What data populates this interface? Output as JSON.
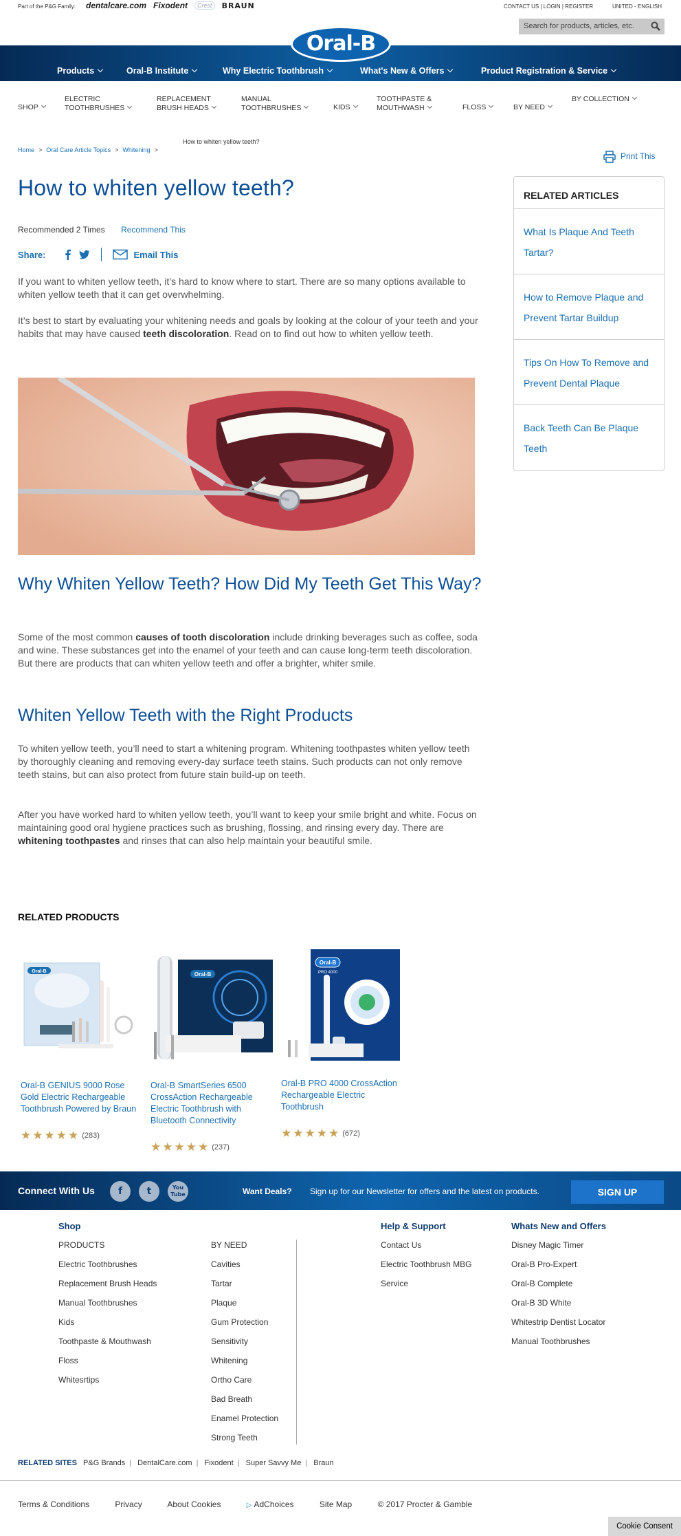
{
  "topbar": {
    "family": "Part of the P&G Family:",
    "brands": [
      "dentalcare.com",
      "Fixodent",
      "Crest",
      "BRAUN"
    ],
    "util": "CONTACT US | LOGIN | REGISTER",
    "region": "UNITED - ENGLISH"
  },
  "search": {
    "placeholder": "Search for products, articles, etc."
  },
  "logo": "Oral-B",
  "mainnav": [
    "Products",
    "Oral-B Institute",
    "Why Electric Toothbrush",
    "What's New & Offers",
    "Product Registration & Service"
  ],
  "subnav": [
    "SHOP",
    "ELECTRIC TOOTHBRUSHES",
    "REPLACEMENT BRUSH HEADS",
    "MANUAL TOOTHBRUSHES",
    "KIDS",
    "TOOTHPASTE & MOUTHWASH",
    "FLOSS",
    "BY NEED",
    "BY COLLECTION"
  ],
  "breadcrumb": {
    "items": [
      "Home",
      "Oral Care Article Topics",
      "Whitening"
    ],
    "sep": ">",
    "current": "How to whiten yellow teeth?"
  },
  "print": "Print This",
  "article": {
    "title": "How to whiten yellow teeth?",
    "recommended": "Recommended 2 Times",
    "recommend_link": "Recommend This",
    "share_label": "Share:",
    "email": "Email This",
    "p1": "If you want to whiten yellow teeth, it’s hard to know where to start. There are so many options available to whiten yellow teeth that it can get overwhelming.",
    "p2a": "It’s best to start by evaluating your whitening needs and goals by looking at the colour of your teeth and your habits that may have caused ",
    "p2b": "teeth discoloration",
    "p2c": ". Read on to find out how to whiten yellow teeth.",
    "h2a": "Why Whiten Yellow Teeth? How Did My Teeth Get This Way?",
    "p3a": "Some of the most common ",
    "p3b": "causes of tooth discoloration",
    "p3c": " include drinking beverages such as coffee, soda and wine. These substances get into the enamel of your teeth and can cause long-term teeth discoloration. But there are products that can whiten yellow teeth and offer a brighter, whiter smile.",
    "h2b": "Whiten Yellow Teeth with the Right Products",
    "p4": "To whiten yellow teeth, you’ll need to start a whitening program. Whitening toothpastes whiten yellow teeth by thoroughly cleaning and removing every-day surface teeth stains. Such products can not only remove teeth stains, but can also protect from future stain build-up on teeth.",
    "p5a": "After you have worked hard to whiten yellow teeth, you’ll want to keep your smile bright and white. Focus on maintaining good oral hygiene practices such as brushing, flossing, and rinsing every day. There are ",
    "p5b": "whitening toothpastes",
    "p5c": " and rinses that can also help maintain your beautiful smile."
  },
  "related_articles": {
    "title": "RELATED ARTICLES",
    "items": [
      "What Is Plaque And Teeth Tartar?",
      "How to Remove Plaque and Prevent Tartar Buildup",
      "Tips On How To Remove and Prevent Dental Plaque",
      "Back Teeth Can Be Plaque Teeth"
    ]
  },
  "related_products": {
    "title": "RELATED PRODUCTS",
    "items": [
      {
        "name": "Oral-B GENIUS 9000 Rose Gold Electric Rechargeable Toothbrush Powered by Braun",
        "stars": "★★★★★",
        "count": "(283)",
        "rating": 5
      },
      {
        "name": "Oral-B SmartSeries 6500 CrossAction Rechargeable Electric Toothbrush with Bluetooth Connectivity",
        "stars": "★★★★★",
        "count": "(237)",
        "rating": 5
      },
      {
        "name": "Oral-B PRO 4000 CrossAction Rechargeable Electric Toothbrush",
        "stars": "★★★★★",
        "count": "(672)",
        "rating": 5
      }
    ],
    "box_labels": [
      "Oral-B",
      "Oral-B",
      "Oral-B",
      "PRO 4000"
    ]
  },
  "connect": {
    "label": "Connect With Us",
    "social": [
      "f",
      "t",
      "You Tube"
    ],
    "deals_label": "Want Deals?",
    "deals_text": "Sign up for our Newsletter for offers and the latest on products.",
    "signup": "SIGN UP"
  },
  "footer": {
    "shop_title": "Shop",
    "shop": [
      "PRODUCTS",
      "Electric Toothbrushes",
      "Replacement Brush Heads",
      "Manual Toothbrushes",
      "Kids",
      "Toothpaste & Mouthwash",
      "Floss",
      "Whitesrtips"
    ],
    "byneed": [
      "BY NEED",
      "Cavities",
      "Tartar",
      "Plaque",
      "Gum Protection",
      "Sensitivity",
      "Whitening",
      "Ortho Care",
      "Bad Breath",
      "Enamel Protection",
      "Strong Teeth"
    ],
    "help_title": "Help & Support",
    "help": [
      "Contact Us",
      "Electric Toothbrush MBG",
      "Service"
    ],
    "new_title": "Whats New and Offers",
    "new": [
      "Disney Magic Timer",
      "Oral-B Pro-Expert",
      "Oral-B Complete",
      "Oral-B 3D White",
      "Whitestrip Dentist Locator",
      "Manual Toothbrushes"
    ],
    "related_sites_label": "RELATED SITES",
    "related_sites": [
      "P&G Brands",
      "DentalCare.com",
      "Fixodent",
      "Super Savvy Me",
      "Braun"
    ],
    "legal": [
      "Terms & Conditions",
      "Privacy",
      "About Cookies",
      "AdChoices",
      "Site Map",
      "© 2017 Procter & Gamble"
    ],
    "cookie": "Cookie Consent"
  },
  "colors": {
    "brand_blue": "#0d4f96",
    "link_blue": "#1a6fb0",
    "nav_dark": "#062a55",
    "star_gold": "#c9a25a"
  }
}
